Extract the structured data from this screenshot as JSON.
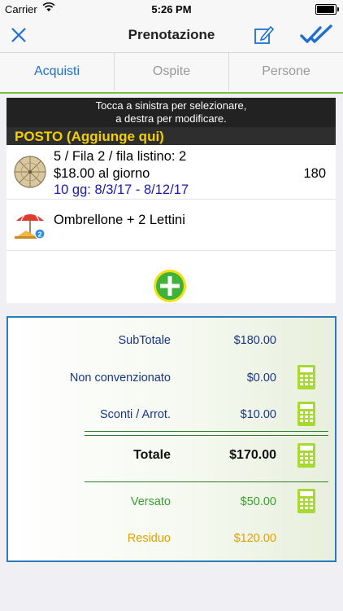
{
  "status_bar": {
    "carrier": "Carrier",
    "time": "5:26 PM"
  },
  "nav": {
    "title": "Prenotazione"
  },
  "tabs": [
    {
      "label": "Acquisti",
      "active": true
    },
    {
      "label": "Ospite",
      "active": false
    },
    {
      "label": "Persone",
      "active": false
    }
  ],
  "instructions": {
    "line1": "Tocca a sinistra per selezionare,",
    "line2": "a destra per modificare."
  },
  "section_header": "POSTO (Aggiunge qui)",
  "items": [
    {
      "icon": "beach-umbrella-icon",
      "line1": "5 / Fila 2 / fila listino: 2",
      "line2": "$18.00 al giorno",
      "line3": "10 gg: 8/3/17 - 8/12/17",
      "amount": "180"
    },
    {
      "icon": "umbrella-loungers-icon",
      "badge": "2",
      "line1": "Ombrellone + 2 Lettini"
    }
  ],
  "summary": {
    "subtotal_label": "SubTotale",
    "subtotal_value": "$180.00",
    "non_conv_label": "Non convenzionato",
    "non_conv_value": "$0.00",
    "sconti_label": "Sconti / Arrot.",
    "sconti_value": "$10.00",
    "totale_label": "Totale",
    "totale_value": "$170.00",
    "versato_label": "Versato",
    "versato_value": "$50.00",
    "residuo_label": "Residuo",
    "residuo_value": "$120.00"
  },
  "colors": {
    "accent_blue": "#1f6fd1",
    "tab_underline": "#7cbf3a",
    "header_yellow": "#f2d000",
    "add_green": "#3fb23a",
    "calculator_green": "#a8d832"
  }
}
